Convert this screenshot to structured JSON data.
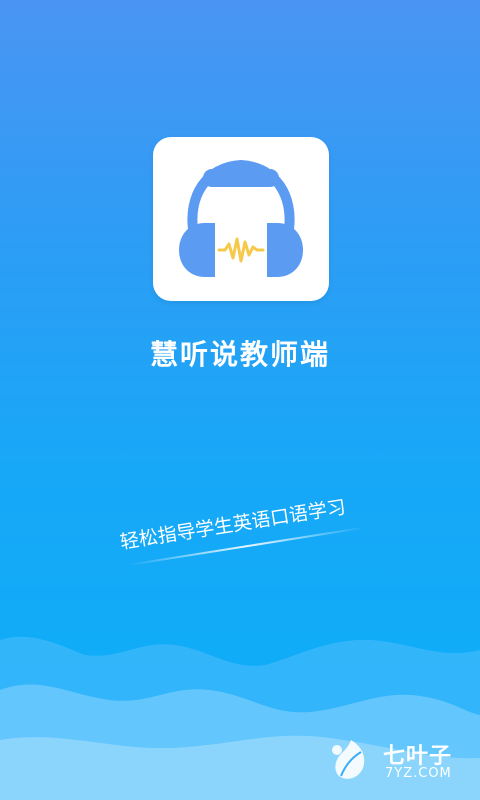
{
  "app": {
    "title": "慧听说教师端",
    "tagline": "轻松指导学生英语口语学习",
    "logo_icon": "headphones-waveform-icon"
  },
  "watermark": {
    "name": "七叶子",
    "domain": "7YZ.COM",
    "icon": "leaf-logo-icon"
  },
  "colors": {
    "background_top": "#4a95f3",
    "background_bottom": "#0aaff9",
    "headphone_blue": "#5b9bf2",
    "waveform_yellow": "#f6c94b",
    "cloud_light": "#7fd0fb"
  }
}
